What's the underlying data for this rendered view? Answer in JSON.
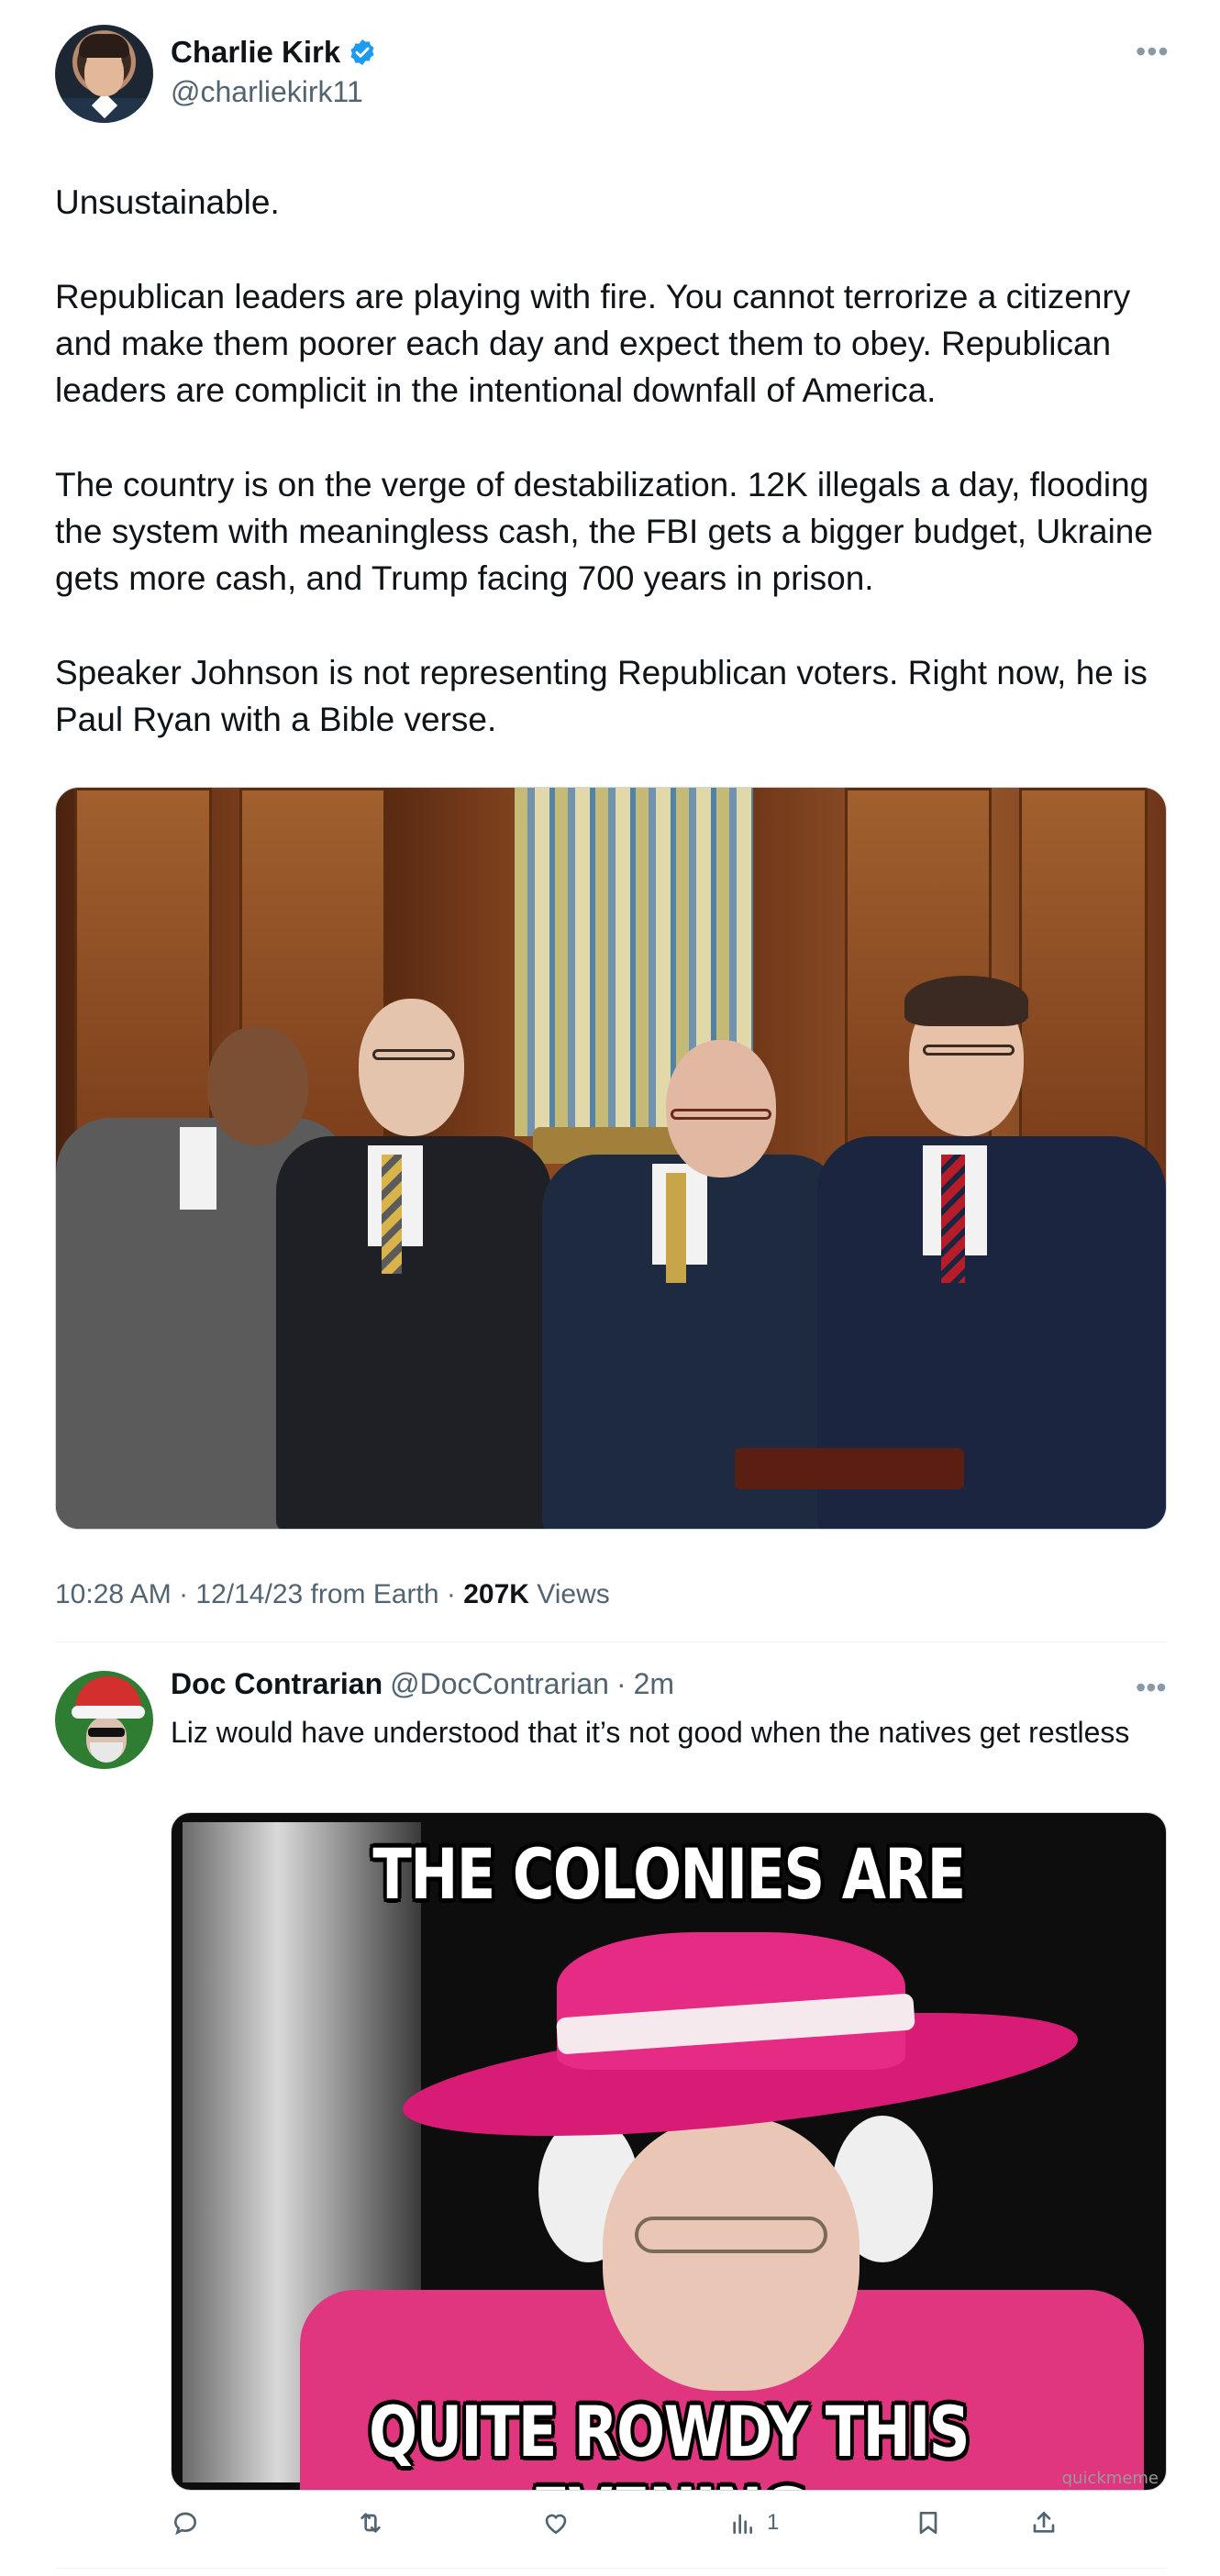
{
  "tweet": {
    "author_name": "Charlie Kirk",
    "author_handle": "@charliekirk11",
    "paragraphs": [
      "Unsustainable.",
      "Republican leaders are playing with fire. You cannot terrorize a citizenry and make them poorer each day and expect them to obey. Republican leaders are complicit in the intentional downfall of America.",
      "The country is on the verge of destabilization. 12K illegals a day, flooding the system with meaningless cash, the FBI gets a bigger budget, Ukraine gets more cash, and Trump facing 700 years in prison.",
      "Speaker Johnson is not representing Republican voters. Right now, he is Paul Ryan with a Bible verse."
    ],
    "meta_prefix": "10:28 AM · 12/14/23 from Earth · ",
    "views_count": "207K",
    "views_label": " Views"
  },
  "reply": {
    "author_name": "Doc Contrarian",
    "author_handle": "@DocContrarian",
    "separator": "·",
    "time": "2m",
    "text": "Liz would have understood that it’s not good when the natives get restless",
    "meme_top": "THE COLONIES ARE",
    "meme_bottom": "QUITE ROWDY THIS EVENING",
    "meme_watermark": "quickmeme"
  },
  "actions": {
    "views_count": "1"
  },
  "icons": [
    "verified-badge-icon",
    "more-icon",
    "reply-icon",
    "retweet-icon",
    "like-icon",
    "views-icon",
    "bookmark-icon",
    "share-icon"
  ],
  "colors": {
    "text": "#0f1419",
    "secondary": "#536471",
    "verified": "#1d9bf0"
  }
}
